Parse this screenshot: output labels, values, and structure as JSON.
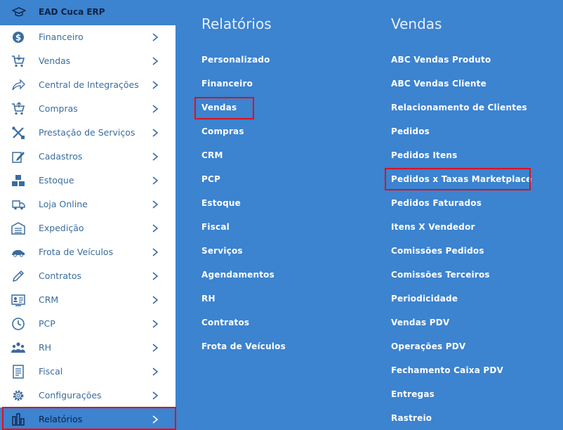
{
  "app": {
    "title": "EAD Cuca ERP"
  },
  "sidebar": {
    "items": [
      {
        "label": "Financeiro",
        "icon": "dollar-circle-icon"
      },
      {
        "label": "Vendas",
        "icon": "cart-icon"
      },
      {
        "label": "Central de Integrações",
        "icon": "share-arrow-icon"
      },
      {
        "label": "Compras",
        "icon": "cart-icon"
      },
      {
        "label": "Prestação de Serviços",
        "icon": "tools-icon"
      },
      {
        "label": "Cadastros",
        "icon": "edit-icon"
      },
      {
        "label": "Estoque",
        "icon": "boxes-icon"
      },
      {
        "label": "Loja Online",
        "icon": "delivery-truck-icon"
      },
      {
        "label": "Expedição",
        "icon": "warehouse-icon"
      },
      {
        "label": "Frota de Veículos",
        "icon": "car-icon"
      },
      {
        "label": "Contratos",
        "icon": "pencil-icon"
      },
      {
        "label": "CRM",
        "icon": "id-card-icon"
      },
      {
        "label": "PCP",
        "icon": "clock-icon"
      },
      {
        "label": "RH",
        "icon": "users-icon"
      },
      {
        "label": "Fiscal",
        "icon": "document-icon"
      },
      {
        "label": "Configurações",
        "icon": "gear-icon"
      },
      {
        "label": "Relatórios",
        "icon": "bar-chart-icon"
      }
    ]
  },
  "reports": {
    "title": "Relatórios",
    "items": [
      "Personalizado",
      "Financeiro",
      "Vendas",
      "Compras",
      "CRM",
      "PCP",
      "Estoque",
      "Fiscal",
      "Serviços",
      "Agendamentos",
      "RH",
      "Contratos",
      "Frota de Veículos"
    ]
  },
  "sales": {
    "title": "Vendas",
    "items": [
      "ABC Vendas Produto",
      "ABC Vendas Cliente",
      "Relacionamento de Clientes",
      "Pedidos",
      "Pedidos Itens",
      "Pedidos x Taxas Marketplace",
      "Pedidos Faturados",
      "Itens X Vendedor",
      "Comissões Pedidos",
      "Comissões Terceiros",
      "Periodicidade",
      "Vendas PDV",
      "Operações PDV",
      "Fechamento Caixa PDV",
      "Entregas",
      "Rastreio"
    ]
  },
  "colors": {
    "accent": "#3c83d0",
    "icon": "#3a6c9f",
    "highlight": "#e0101a"
  }
}
